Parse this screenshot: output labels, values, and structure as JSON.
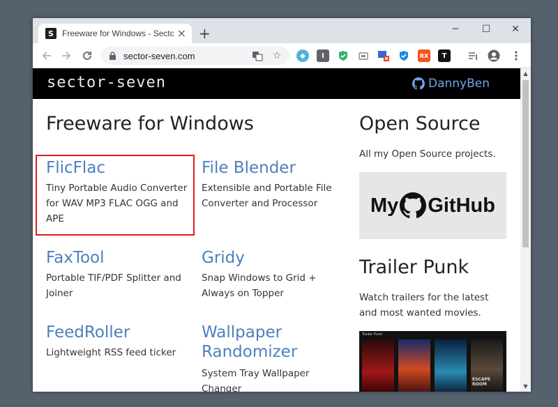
{
  "browser": {
    "tab_title": "Freeware for Windows - Sector",
    "url": "sector-seven.com",
    "new_tab_symbol": "+",
    "window_controls": {
      "minimize": "─",
      "maximize": "☐",
      "close": "✕"
    },
    "extensions": [
      "vpn-icon",
      "instapaper-icon",
      "adblock-icon",
      "screenshot-icon",
      "tab-manager-icon",
      "shield-icon",
      "ext-rx-icon",
      "ext-t-icon"
    ]
  },
  "site": {
    "logo_text": "sector-seven",
    "github_user": "DannyBen"
  },
  "main": {
    "heading": "Freeware for Windows",
    "apps": [
      {
        "title": "FlicFlac",
        "desc": "Tiny Portable Audio Converter for WAV MP3 FLAC OGG and APE"
      },
      {
        "title": "File Blender",
        "desc": "Extensible and Portable File Converter and Processor"
      },
      {
        "title": "FaxTool",
        "desc": "Portable TIF/PDF Splitter and Joiner"
      },
      {
        "title": "Gridy",
        "desc": "Snap Windows to Grid + Always on Topper"
      },
      {
        "title": "FeedRoller",
        "desc": "Lightweight RSS feed ticker"
      },
      {
        "title": "Wallpaper Randomizer",
        "desc": "System Tray Wallpaper Changer"
      }
    ]
  },
  "sidebar": {
    "open_source_heading": "Open Source",
    "open_source_desc": "All my Open Source projects.",
    "github_banner_my": "My",
    "github_banner_github": "GitHub",
    "trailer_heading": "Trailer Punk",
    "trailer_desc": "Watch trailers for the latest and most wanted movies.",
    "trailer_img_caption": "Trailer Punk",
    "poster_caption": "ESCAPE ROOM"
  },
  "colors": {
    "link": "#4d7fbd",
    "header_bg": "#000000",
    "highlight": "#e01b1b",
    "github_link": "#6ea6e8"
  }
}
